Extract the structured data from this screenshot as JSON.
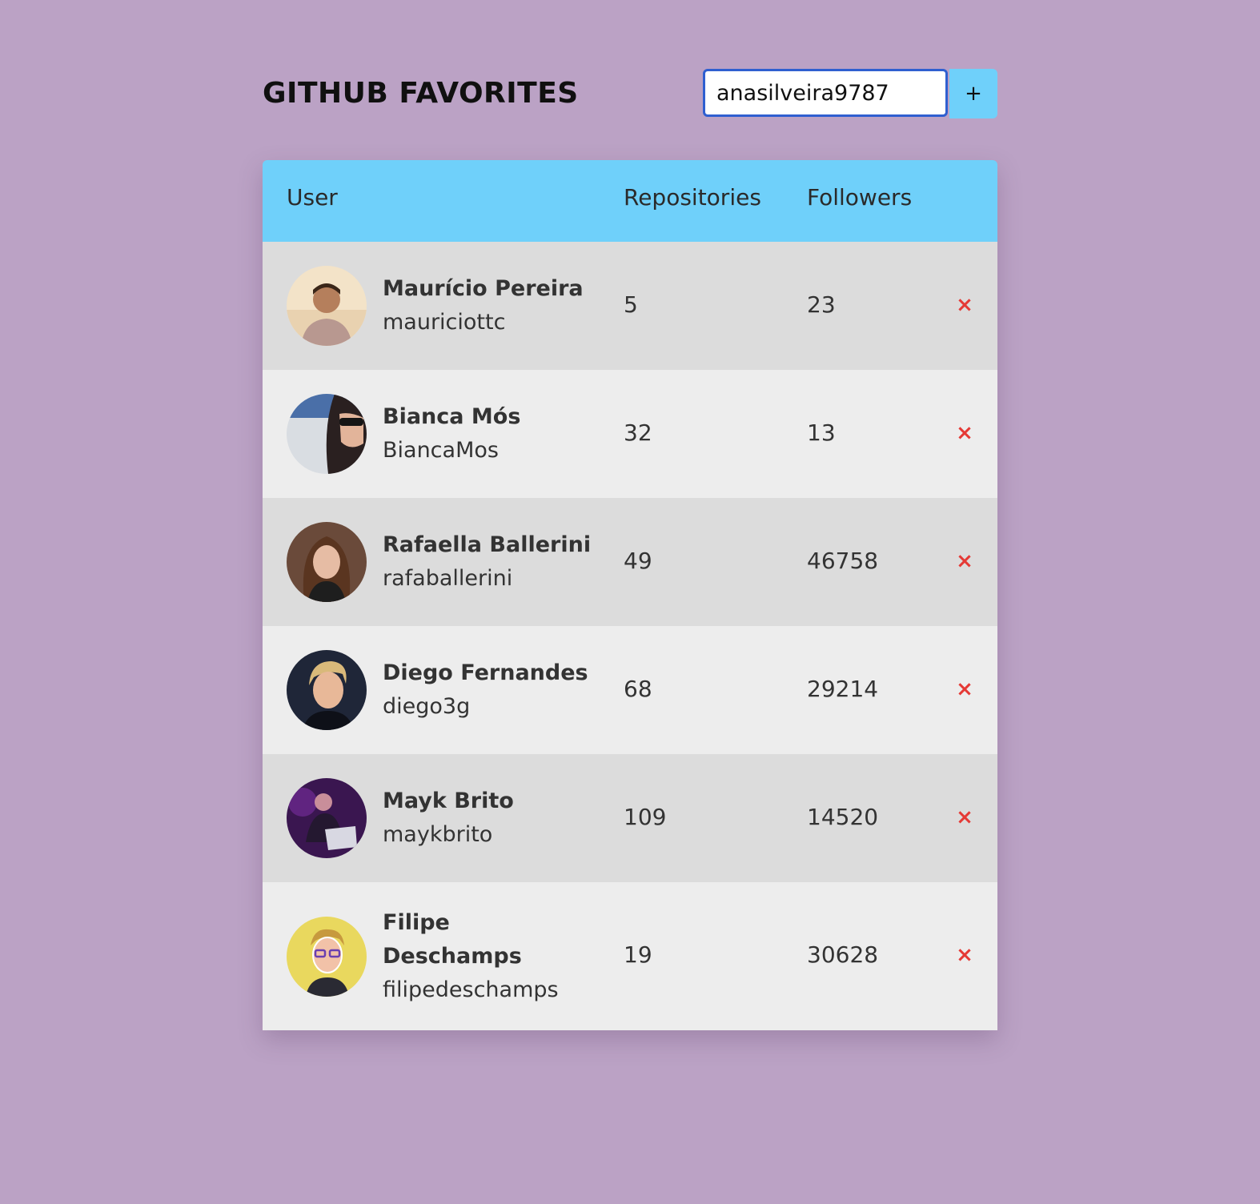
{
  "header": {
    "title": "GITHUB FAVORITES",
    "search_value": "anasilveira9787",
    "add_label": "+"
  },
  "table": {
    "columns": [
      "User",
      "Repositories",
      "Followers"
    ],
    "remove_label": "×",
    "rows": [
      {
        "name": "Maurício Pereira",
        "login": "mauriciottc",
        "repositories": "5",
        "followers": "23",
        "avatar": "avatar-photo"
      },
      {
        "name": "Bianca Mós",
        "login": "BiancaMos",
        "repositories": "32",
        "followers": "13",
        "avatar": "avatar-photo"
      },
      {
        "name": "Rafaella Ballerini",
        "login": "rafaballerini",
        "repositories": "49",
        "followers": "46758",
        "avatar": "avatar-photo"
      },
      {
        "name": "Diego Fernandes",
        "login": "diego3g",
        "repositories": "68",
        "followers": "29214",
        "avatar": "avatar-illustration"
      },
      {
        "name": "Mayk Brito",
        "login": "maykbrito",
        "repositories": "109",
        "followers": "14520",
        "avatar": "avatar-photo"
      },
      {
        "name": "Filipe Deschamps",
        "login": "filipedeschamps",
        "repositories": "19",
        "followers": "30628",
        "avatar": "avatar-illustration"
      }
    ]
  },
  "colors": {
    "background": "#BBA2C5",
    "accent": "#6FD0FA",
    "row_odd": "#DCDCDC",
    "row_even": "#EDEDED",
    "remove": "#E53935",
    "input_border": "#2F5FD0"
  }
}
